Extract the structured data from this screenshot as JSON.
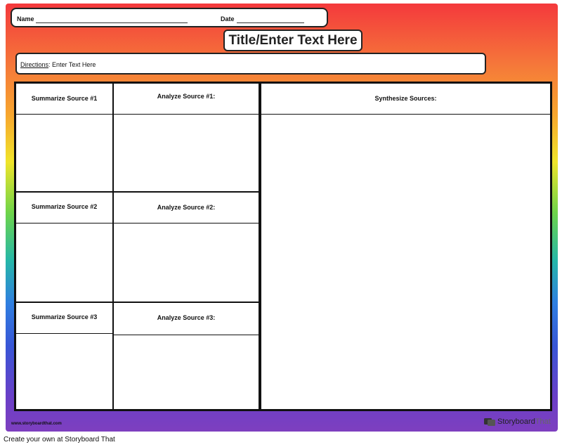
{
  "header": {
    "name_label": "Name",
    "date_label": "Date"
  },
  "title": "Title/Enter Text Here",
  "directions": {
    "label": "Directions",
    "text": ": Enter Text Here"
  },
  "cells": {
    "summarize": [
      "Summarize Source #1",
      "Summarize Source #2",
      "Summarize Source #3"
    ],
    "analyze": [
      "Analyze Source #1:",
      "Analyze Source #2:",
      "Analyze Source #3:"
    ],
    "synthesize": "Synthesize Sources:"
  },
  "footer": {
    "url": "www.storyboardthat.com",
    "brand_a": "Storyboard",
    "brand_b": "That",
    "caption": "Create your own at Storyboard That"
  }
}
